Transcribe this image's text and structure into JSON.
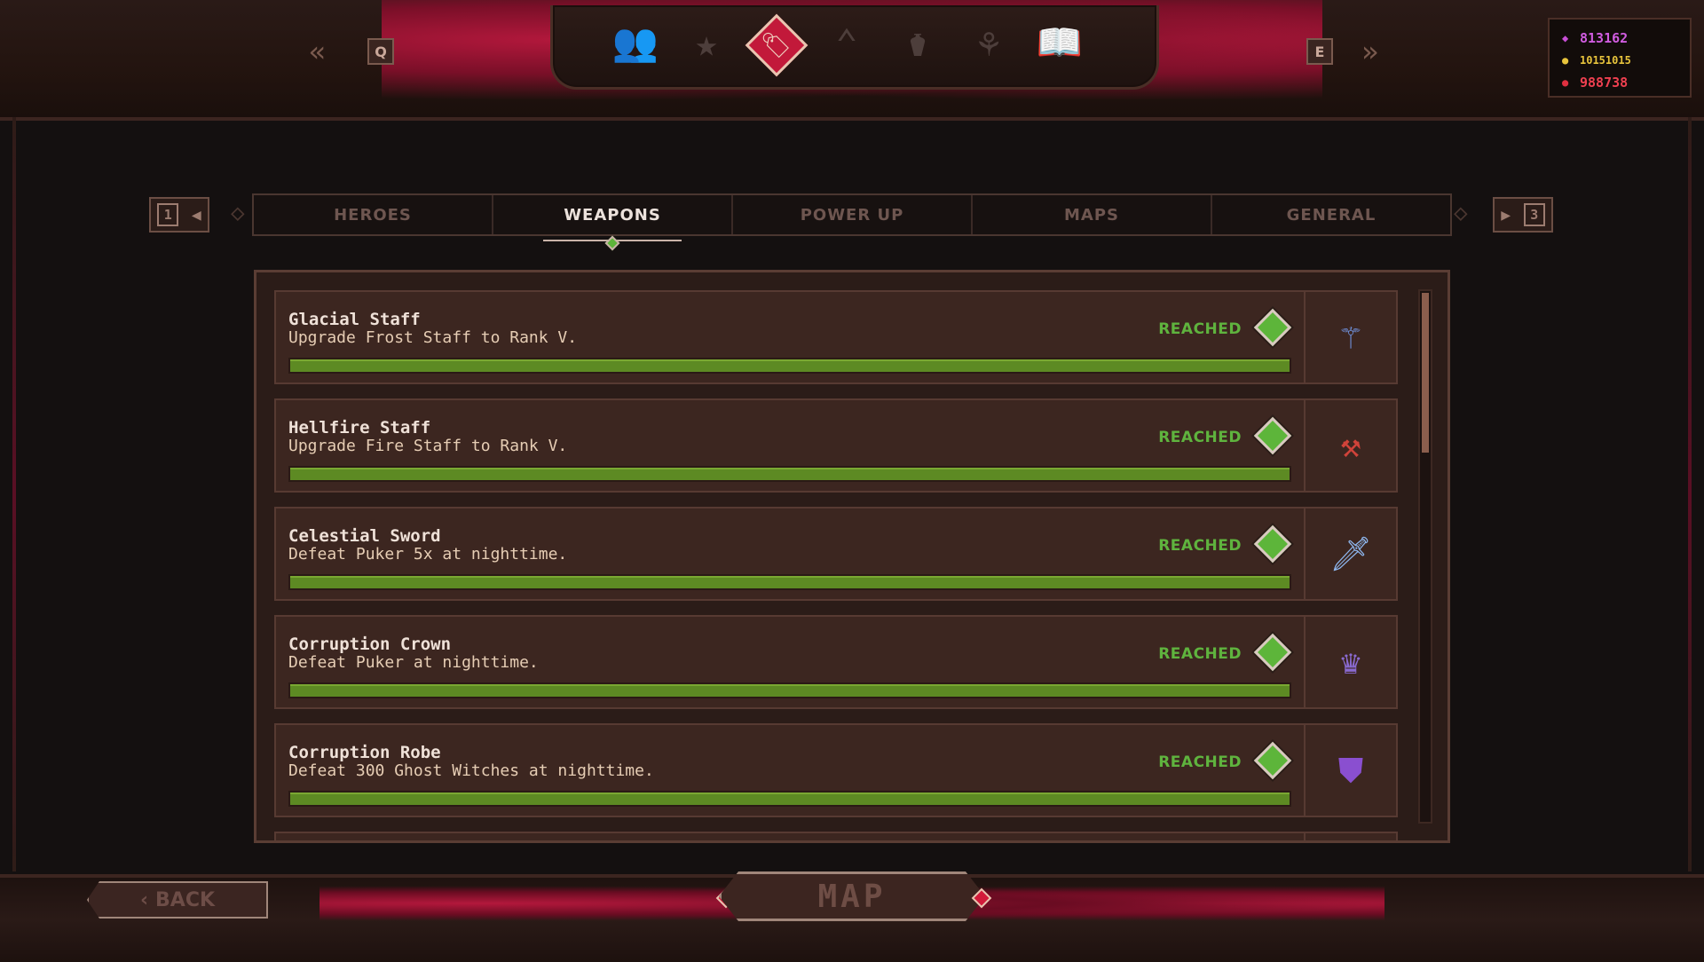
{
  "nav": {
    "prev_key": "Q",
    "next_key": "E",
    "icons": [
      {
        "name": "heroes-icon",
        "glyph": "👥",
        "active": false
      },
      {
        "name": "star-icon",
        "glyph": "★",
        "active": false
      },
      {
        "name": "achievement-tag-icon",
        "glyph": "🏷",
        "active": true
      },
      {
        "name": "rank-chevron-icon",
        "glyph": "⌃",
        "active": false
      },
      {
        "name": "potion-icon",
        "glyph": "⚱",
        "active": false
      },
      {
        "name": "tree-icon",
        "glyph": "⚘",
        "active": false
      },
      {
        "name": "book-icon",
        "glyph": "📖",
        "active": false
      }
    ]
  },
  "currency": {
    "gems": "813162",
    "gold": "10151015",
    "souls": "988738",
    "colors": {
      "gems": "#c84fd6",
      "gold": "#e8c43c",
      "souls": "#e03040"
    }
  },
  "tabs": {
    "prev_page": "1",
    "next_page": "3",
    "items": [
      "HEROES",
      "WEAPONS",
      "POWER UP",
      "MAPS",
      "GENERAL"
    ],
    "active_index": 1
  },
  "achievements": [
    {
      "title": "Glacial Staff",
      "desc": "Upgrade Frost Staff to Rank V.",
      "status": "REACHED",
      "progress": 1.0,
      "icon": "frost-staff-icon",
      "glyph": "⚚",
      "icon_color": "#6f8fd8"
    },
    {
      "title": "Hellfire Staff",
      "desc": "Upgrade Fire Staff to Rank V.",
      "status": "REACHED",
      "progress": 1.0,
      "icon": "fire-staff-icon",
      "glyph": "⚒",
      "icon_color": "#d0433a"
    },
    {
      "title": "Celestial Sword",
      "desc": "Defeat Puker 5x at nighttime.",
      "status": "REACHED",
      "progress": 1.0,
      "icon": "sword-icon",
      "glyph": "🗡",
      "icon_color": "#8fb8f0"
    },
    {
      "title": "Corruption Crown",
      "desc": "Defeat Puker at nighttime.",
      "status": "REACHED",
      "progress": 1.0,
      "icon": "crown-icon",
      "glyph": "♛",
      "icon_color": "#8a6ad0"
    },
    {
      "title": "Corruption Robe",
      "desc": "Defeat 300 Ghost Witches at nighttime.",
      "status": "REACHED",
      "progress": 1.0,
      "icon": "robe-icon",
      "glyph": "⛊",
      "icon_color": "#8a4fd0"
    }
  ],
  "footer": {
    "back_label": "BACK",
    "map_label": "MAP"
  }
}
